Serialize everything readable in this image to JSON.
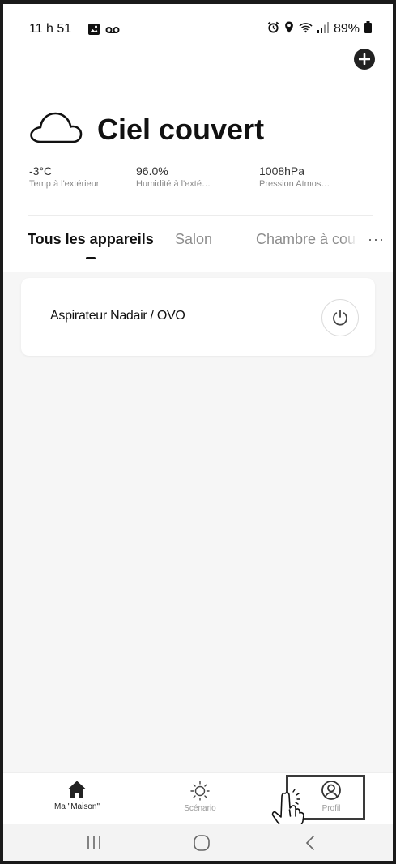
{
  "status_bar": {
    "time": "11 h 51",
    "battery_percent": "89%",
    "icons": [
      "gallery-icon",
      "voicemail-icon",
      "alarm-icon",
      "location-icon",
      "wifi-icon",
      "signal-icon",
      "battery-icon"
    ]
  },
  "header": {
    "add_icon": "plus-circle-icon"
  },
  "weather": {
    "icon": "cloud-icon",
    "condition": "Ciel couvert",
    "stats": [
      {
        "value": "-3°C",
        "label": "Temp à l'extérieur"
      },
      {
        "value": "96.0%",
        "label": "Humidité à l'exté…"
      },
      {
        "value": "1008hPa",
        "label": "Pression Atmos…"
      }
    ]
  },
  "tabs": {
    "items": [
      {
        "label": "Tous les appareils",
        "active": true
      },
      {
        "label": "Salon",
        "active": false
      },
      {
        "label": "Chambre à cou",
        "active": false
      }
    ],
    "more_label": "···"
  },
  "devices": [
    {
      "name": "Aspirateur Nadair / OVO",
      "power_icon": "power-icon"
    }
  ],
  "bottom_nav": {
    "items": [
      {
        "label": "Ma \"Maison\"",
        "icon": "home-icon",
        "active": true
      },
      {
        "label": "Scénario",
        "icon": "sun-icon",
        "active": false
      },
      {
        "label": "Profil",
        "icon": "profile-icon",
        "active": false
      }
    ]
  },
  "system_nav": {
    "recents": "|||",
    "home": "home-button",
    "back": "<"
  },
  "colors": {
    "primary_text": "#111111",
    "secondary_text": "#8d8d8d",
    "background": "#f6f6f6",
    "card": "#ffffff"
  }
}
